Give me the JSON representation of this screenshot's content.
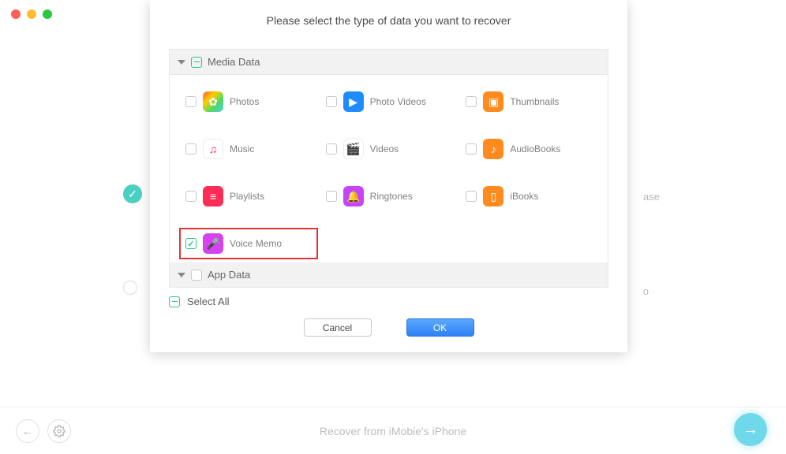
{
  "title": "Please select the type of data you want to recover",
  "sections": {
    "media": {
      "title": "Media Data",
      "items": [
        {
          "label": "Photos",
          "icon": "photos",
          "checked": false
        },
        {
          "label": "Photo Videos",
          "icon": "photo-videos",
          "checked": false
        },
        {
          "label": "Thumbnails",
          "icon": "thumbnails",
          "checked": false
        },
        {
          "label": "Music",
          "icon": "music",
          "checked": false
        },
        {
          "label": "Videos",
          "icon": "videos",
          "checked": false
        },
        {
          "label": "AudioBooks",
          "icon": "audiobooks",
          "checked": false
        },
        {
          "label": "Playlists",
          "icon": "playlists",
          "checked": false
        },
        {
          "label": "Ringtones",
          "icon": "ringtones",
          "checked": false
        },
        {
          "label": "iBooks",
          "icon": "ibooks",
          "checked": false
        },
        {
          "label": "Voice Memo",
          "icon": "voice-memo",
          "checked": true,
          "highlighted": true
        }
      ]
    },
    "app": {
      "title": "App Data"
    }
  },
  "select_all_label": "Select All",
  "buttons": {
    "cancel": "Cancel",
    "ok": "OK"
  },
  "background": {
    "text1": "ase",
    "text2": "o"
  },
  "footer": {
    "text": "Recover from iMobie's iPhone"
  }
}
